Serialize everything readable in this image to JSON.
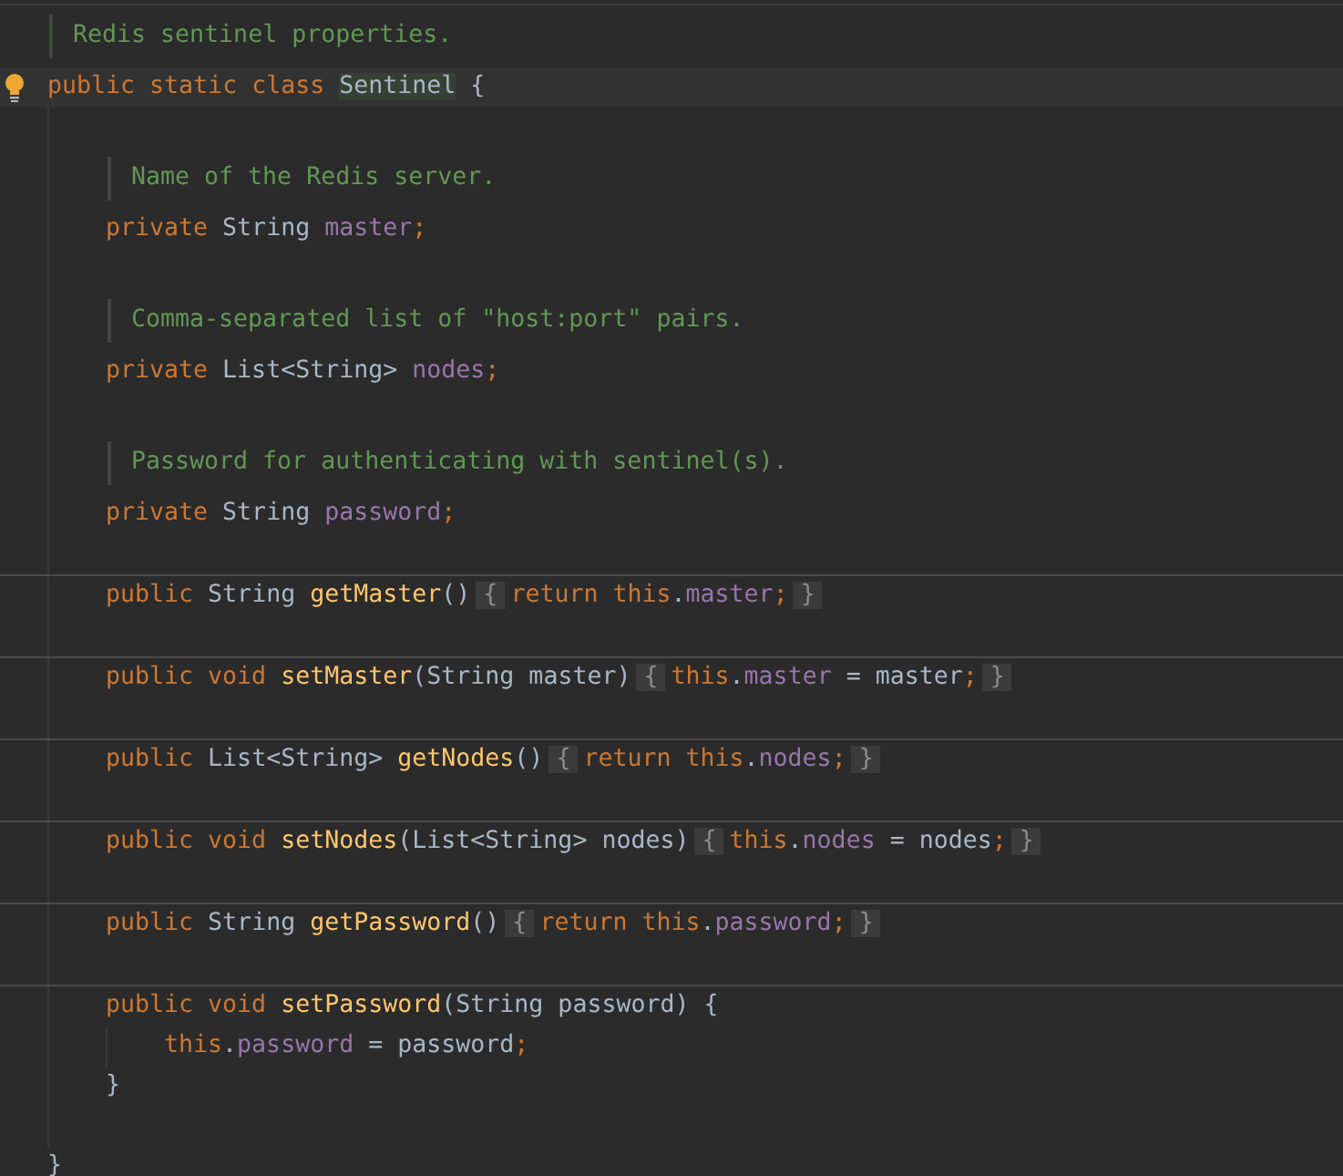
{
  "lines": [
    {
      "kind": "doc",
      "text": "Redis sentinel properties."
    },
    {
      "kind": "code",
      "caret_line": true,
      "bulb": true,
      "tokens": [
        {
          "text": "public static class ",
          "kind": "keyword"
        },
        {
          "text": "Sentinel",
          "kind": "highlighted"
        },
        {
          "text": " {",
          "kind": "plain"
        }
      ],
      "children": [
        {
          "kind": "blank"
        },
        {
          "kind": "doc",
          "text": "Name of the Redis server."
        },
        {
          "kind": "code",
          "tokens": [
            {
              "text": "private ",
              "kind": "keyword"
            },
            {
              "text": "String ",
              "kind": "plain"
            },
            {
              "text": "master",
              "kind": "field"
            },
            {
              "text": ";",
              "kind": "keyword"
            }
          ]
        },
        {
          "kind": "blank"
        },
        {
          "kind": "doc",
          "text": "Comma-separated list of \"host:port\" pairs."
        },
        {
          "kind": "code",
          "tokens": [
            {
              "text": "private ",
              "kind": "keyword"
            },
            {
              "text": "List<String> ",
              "kind": "plain"
            },
            {
              "text": "nodes",
              "kind": "field"
            },
            {
              "text": ";",
              "kind": "keyword"
            }
          ]
        },
        {
          "kind": "blank"
        },
        {
          "kind": "doc",
          "text": "Password for authenticating with sentinel(s)."
        },
        {
          "kind": "code",
          "tokens": [
            {
              "text": "private ",
              "kind": "keyword"
            },
            {
              "text": "String ",
              "kind": "plain"
            },
            {
              "text": "password",
              "kind": "field"
            },
            {
              "text": ";",
              "kind": "keyword"
            }
          ]
        },
        {
          "kind": "blank"
        },
        {
          "kind": "divider"
        },
        {
          "kind": "code",
          "tokens": [
            {
              "text": "public ",
              "kind": "keyword"
            },
            {
              "text": "String ",
              "kind": "plain"
            },
            {
              "text": "getMaster",
              "kind": "method"
            },
            {
              "text": "()",
              "kind": "plain"
            },
            {
              "text": "{",
              "kind": "fold"
            },
            {
              "text": "return this",
              "kind": "keyword"
            },
            {
              "text": ".",
              "kind": "plain"
            },
            {
              "text": "master",
              "kind": "field"
            },
            {
              "text": ";",
              "kind": "keyword"
            },
            {
              "text": "}",
              "kind": "fold"
            }
          ]
        },
        {
          "kind": "blank"
        },
        {
          "kind": "divider"
        },
        {
          "kind": "code",
          "tokens": [
            {
              "text": "public void ",
              "kind": "keyword"
            },
            {
              "text": "setMaster",
              "kind": "method"
            },
            {
              "text": "(String master)",
              "kind": "plain"
            },
            {
              "text": "{",
              "kind": "fold"
            },
            {
              "text": "this",
              "kind": "keyword"
            },
            {
              "text": ".",
              "kind": "plain"
            },
            {
              "text": "master",
              "kind": "field"
            },
            {
              "text": " = master",
              "kind": "plain"
            },
            {
              "text": ";",
              "kind": "keyword"
            },
            {
              "text": "}",
              "kind": "fold"
            }
          ]
        },
        {
          "kind": "blank"
        },
        {
          "kind": "divider"
        },
        {
          "kind": "code",
          "tokens": [
            {
              "text": "public ",
              "kind": "keyword"
            },
            {
              "text": "List<String> ",
              "kind": "plain"
            },
            {
              "text": "getNodes",
              "kind": "method"
            },
            {
              "text": "()",
              "kind": "plain"
            },
            {
              "text": "{",
              "kind": "fold"
            },
            {
              "text": "return this",
              "kind": "keyword"
            },
            {
              "text": ".",
              "kind": "plain"
            },
            {
              "text": "nodes",
              "kind": "field"
            },
            {
              "text": ";",
              "kind": "keyword"
            },
            {
              "text": "}",
              "kind": "fold"
            }
          ]
        },
        {
          "kind": "blank"
        },
        {
          "kind": "divider"
        },
        {
          "kind": "code",
          "tokens": [
            {
              "text": "public void ",
              "kind": "keyword"
            },
            {
              "text": "setNodes",
              "kind": "method"
            },
            {
              "text": "(List<String> nodes)",
              "kind": "plain"
            },
            {
              "text": "{",
              "kind": "fold"
            },
            {
              "text": "this",
              "kind": "keyword"
            },
            {
              "text": ".",
              "kind": "plain"
            },
            {
              "text": "nodes",
              "kind": "field"
            },
            {
              "text": " = nodes",
              "kind": "plain"
            },
            {
              "text": ";",
              "kind": "keyword"
            },
            {
              "text": "}",
              "kind": "fold"
            }
          ]
        },
        {
          "kind": "blank"
        },
        {
          "kind": "divider"
        },
        {
          "kind": "code",
          "tokens": [
            {
              "text": "public ",
              "kind": "keyword"
            },
            {
              "text": "String ",
              "kind": "plain"
            },
            {
              "text": "getPassword",
              "kind": "method"
            },
            {
              "text": "()",
              "kind": "plain"
            },
            {
              "text": "{",
              "kind": "fold"
            },
            {
              "text": "return this",
              "kind": "keyword"
            },
            {
              "text": ".",
              "kind": "plain"
            },
            {
              "text": "password",
              "kind": "field"
            },
            {
              "text": ";",
              "kind": "keyword"
            },
            {
              "text": "}",
              "kind": "fold"
            }
          ]
        },
        {
          "kind": "blank"
        },
        {
          "kind": "divider"
        },
        {
          "kind": "code",
          "tokens": [
            {
              "text": "public void ",
              "kind": "keyword"
            },
            {
              "text": "setPassword",
              "kind": "method"
            },
            {
              "text": "(String password) {",
              "kind": "plain"
            }
          ],
          "children": [
            {
              "kind": "code",
              "tokens": [
                {
                  "text": "this",
                  "kind": "keyword"
                },
                {
                  "text": ".",
                  "kind": "plain"
                },
                {
                  "text": "password",
                  "kind": "field"
                },
                {
                  "text": " = password",
                  "kind": "plain"
                },
                {
                  "text": ";",
                  "kind": "keyword"
                }
              ]
            }
          ]
        },
        {
          "kind": "code",
          "tokens": [
            {
              "text": "}",
              "kind": "plain"
            }
          ]
        },
        {
          "kind": "blank"
        }
      ]
    },
    {
      "kind": "code",
      "tokens": [
        {
          "text": "}",
          "kind": "plain"
        }
      ]
    }
  ]
}
